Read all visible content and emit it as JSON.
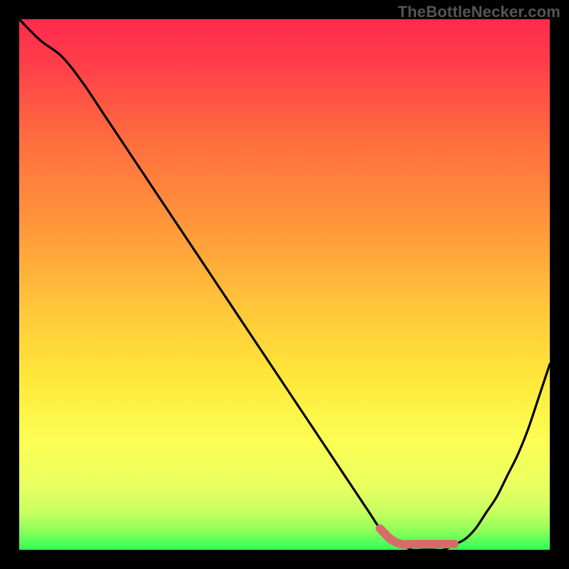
{
  "watermark": "TheBottleNecker.com",
  "colors": {
    "frame": "#000000",
    "gradient_top": "#ff2a4d",
    "gradient_mid_upper": "#ff7a3a",
    "gradient_mid": "#ffe03a",
    "gradient_mid_lower": "#f7ff66",
    "gradient_bottom": "#2aff5a",
    "curve": "#000000",
    "curve_highlight": "#d96a6a"
  },
  "chart_data": {
    "type": "line",
    "title": "",
    "xlabel": "",
    "ylabel": "",
    "xlim": [
      0,
      100
    ],
    "ylim": [
      0,
      100
    ],
    "series": [
      {
        "name": "bottleneck_curve",
        "x": [
          0,
          4,
          8,
          12,
          16,
          20,
          24,
          28,
          32,
          36,
          40,
          44,
          48,
          52,
          56,
          60,
          62,
          64,
          66,
          68,
          70,
          72,
          74,
          76,
          78,
          80,
          82,
          84,
          86,
          88,
          90,
          92,
          94,
          96,
          98,
          100
        ],
        "values": [
          100,
          96,
          93,
          88,
          82,
          76,
          70,
          64,
          58,
          52,
          46,
          40,
          34,
          28,
          22,
          16,
          13,
          10,
          7,
          4,
          2,
          1,
          0,
          0,
          0,
          0,
          1,
          2,
          4,
          7,
          10,
          14,
          18,
          23,
          29,
          35
        ]
      }
    ],
    "highlight_segment": {
      "series": "bottleneck_curve",
      "x_start": 68,
      "x_end": 82,
      "note": "thick colored segment near minimum"
    }
  }
}
